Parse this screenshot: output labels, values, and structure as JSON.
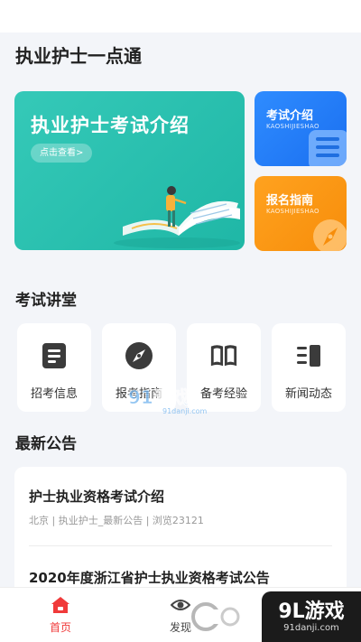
{
  "header": {
    "title": "执业护士一点通"
  },
  "hero": {
    "title": "执业护士考试介绍",
    "button_label": "点击查看>",
    "illustration_icon": "open-book-reader-icon",
    "color": "#22bba8"
  },
  "side_cards": [
    {
      "title": "考试介绍",
      "subtitle": "KAOSHIJIESHAO",
      "icon": "list-icon",
      "color": "#2a85fb"
    },
    {
      "title": "报名指南",
      "subtitle": "KAOSHIJIESHAO",
      "icon": "compass-icon",
      "color": "#fa9712"
    }
  ],
  "lecture": {
    "title": "考试讲堂",
    "items": [
      {
        "label": "招考信息",
        "icon": "document-icon"
      },
      {
        "label": "报考指南",
        "icon": "compass-icon"
      },
      {
        "label": "备考经验",
        "icon": "book-icon"
      },
      {
        "label": "新闻动态",
        "icon": "news-icon"
      }
    ]
  },
  "announcements": {
    "title": "最新公告",
    "items": [
      {
        "title": "护士执业资格考试介绍",
        "meta": "北京 | 执业护士_最新公告 | 浏览23121"
      },
      {
        "title": "2020年度浙江省护士执业资格考试公告",
        "meta": ""
      }
    ]
  },
  "tabbar": {
    "items": [
      {
        "label": "首页",
        "icon": "home-icon",
        "active": true
      },
      {
        "label": "发现",
        "icon": "eye-icon",
        "active": false
      }
    ],
    "active_color": "#f03a3a"
  },
  "watermarks": {
    "center_main": "91游戏",
    "center_sub": "91danji.com",
    "corner_main": "9L游戏",
    "corner_sub": "91danji.com"
  }
}
